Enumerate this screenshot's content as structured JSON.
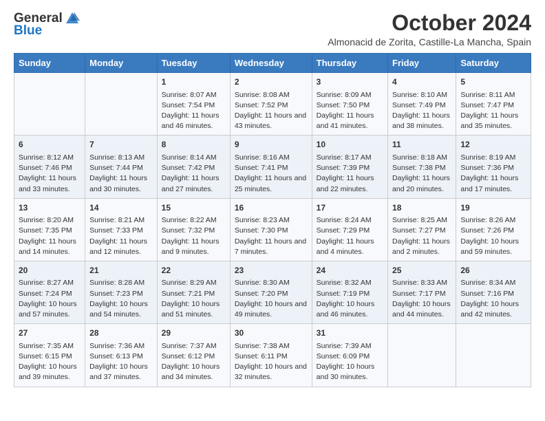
{
  "header": {
    "logo_general": "General",
    "logo_blue": "Blue",
    "month_title": "October 2024",
    "subtitle": "Almonacid de Zorita, Castille-La Mancha, Spain"
  },
  "days_of_week": [
    "Sunday",
    "Monday",
    "Tuesday",
    "Wednesday",
    "Thursday",
    "Friday",
    "Saturday"
  ],
  "weeks": [
    [
      {
        "day": "",
        "sunrise": "",
        "sunset": "",
        "daylight": ""
      },
      {
        "day": "",
        "sunrise": "",
        "sunset": "",
        "daylight": ""
      },
      {
        "day": "1",
        "sunrise": "Sunrise: 8:07 AM",
        "sunset": "Sunset: 7:54 PM",
        "daylight": "Daylight: 11 hours and 46 minutes."
      },
      {
        "day": "2",
        "sunrise": "Sunrise: 8:08 AM",
        "sunset": "Sunset: 7:52 PM",
        "daylight": "Daylight: 11 hours and 43 minutes."
      },
      {
        "day": "3",
        "sunrise": "Sunrise: 8:09 AM",
        "sunset": "Sunset: 7:50 PM",
        "daylight": "Daylight: 11 hours and 41 minutes."
      },
      {
        "day": "4",
        "sunrise": "Sunrise: 8:10 AM",
        "sunset": "Sunset: 7:49 PM",
        "daylight": "Daylight: 11 hours and 38 minutes."
      },
      {
        "day": "5",
        "sunrise": "Sunrise: 8:11 AM",
        "sunset": "Sunset: 7:47 PM",
        "daylight": "Daylight: 11 hours and 35 minutes."
      }
    ],
    [
      {
        "day": "6",
        "sunrise": "Sunrise: 8:12 AM",
        "sunset": "Sunset: 7:46 PM",
        "daylight": "Daylight: 11 hours and 33 minutes."
      },
      {
        "day": "7",
        "sunrise": "Sunrise: 8:13 AM",
        "sunset": "Sunset: 7:44 PM",
        "daylight": "Daylight: 11 hours and 30 minutes."
      },
      {
        "day": "8",
        "sunrise": "Sunrise: 8:14 AM",
        "sunset": "Sunset: 7:42 PM",
        "daylight": "Daylight: 11 hours and 27 minutes."
      },
      {
        "day": "9",
        "sunrise": "Sunrise: 8:16 AM",
        "sunset": "Sunset: 7:41 PM",
        "daylight": "Daylight: 11 hours and 25 minutes."
      },
      {
        "day": "10",
        "sunrise": "Sunrise: 8:17 AM",
        "sunset": "Sunset: 7:39 PM",
        "daylight": "Daylight: 11 hours and 22 minutes."
      },
      {
        "day": "11",
        "sunrise": "Sunrise: 8:18 AM",
        "sunset": "Sunset: 7:38 PM",
        "daylight": "Daylight: 11 hours and 20 minutes."
      },
      {
        "day": "12",
        "sunrise": "Sunrise: 8:19 AM",
        "sunset": "Sunset: 7:36 PM",
        "daylight": "Daylight: 11 hours and 17 minutes."
      }
    ],
    [
      {
        "day": "13",
        "sunrise": "Sunrise: 8:20 AM",
        "sunset": "Sunset: 7:35 PM",
        "daylight": "Daylight: 11 hours and 14 minutes."
      },
      {
        "day": "14",
        "sunrise": "Sunrise: 8:21 AM",
        "sunset": "Sunset: 7:33 PM",
        "daylight": "Daylight: 11 hours and 12 minutes."
      },
      {
        "day": "15",
        "sunrise": "Sunrise: 8:22 AM",
        "sunset": "Sunset: 7:32 PM",
        "daylight": "Daylight: 11 hours and 9 minutes."
      },
      {
        "day": "16",
        "sunrise": "Sunrise: 8:23 AM",
        "sunset": "Sunset: 7:30 PM",
        "daylight": "Daylight: 11 hours and 7 minutes."
      },
      {
        "day": "17",
        "sunrise": "Sunrise: 8:24 AM",
        "sunset": "Sunset: 7:29 PM",
        "daylight": "Daylight: 11 hours and 4 minutes."
      },
      {
        "day": "18",
        "sunrise": "Sunrise: 8:25 AM",
        "sunset": "Sunset: 7:27 PM",
        "daylight": "Daylight: 11 hours and 2 minutes."
      },
      {
        "day": "19",
        "sunrise": "Sunrise: 8:26 AM",
        "sunset": "Sunset: 7:26 PM",
        "daylight": "Daylight: 10 hours and 59 minutes."
      }
    ],
    [
      {
        "day": "20",
        "sunrise": "Sunrise: 8:27 AM",
        "sunset": "Sunset: 7:24 PM",
        "daylight": "Daylight: 10 hours and 57 minutes."
      },
      {
        "day": "21",
        "sunrise": "Sunrise: 8:28 AM",
        "sunset": "Sunset: 7:23 PM",
        "daylight": "Daylight: 10 hours and 54 minutes."
      },
      {
        "day": "22",
        "sunrise": "Sunrise: 8:29 AM",
        "sunset": "Sunset: 7:21 PM",
        "daylight": "Daylight: 10 hours and 51 minutes."
      },
      {
        "day": "23",
        "sunrise": "Sunrise: 8:30 AM",
        "sunset": "Sunset: 7:20 PM",
        "daylight": "Daylight: 10 hours and 49 minutes."
      },
      {
        "day": "24",
        "sunrise": "Sunrise: 8:32 AM",
        "sunset": "Sunset: 7:19 PM",
        "daylight": "Daylight: 10 hours and 46 minutes."
      },
      {
        "day": "25",
        "sunrise": "Sunrise: 8:33 AM",
        "sunset": "Sunset: 7:17 PM",
        "daylight": "Daylight: 10 hours and 44 minutes."
      },
      {
        "day": "26",
        "sunrise": "Sunrise: 8:34 AM",
        "sunset": "Sunset: 7:16 PM",
        "daylight": "Daylight: 10 hours and 42 minutes."
      }
    ],
    [
      {
        "day": "27",
        "sunrise": "Sunrise: 7:35 AM",
        "sunset": "Sunset: 6:15 PM",
        "daylight": "Daylight: 10 hours and 39 minutes."
      },
      {
        "day": "28",
        "sunrise": "Sunrise: 7:36 AM",
        "sunset": "Sunset: 6:13 PM",
        "daylight": "Daylight: 10 hours and 37 minutes."
      },
      {
        "day": "29",
        "sunrise": "Sunrise: 7:37 AM",
        "sunset": "Sunset: 6:12 PM",
        "daylight": "Daylight: 10 hours and 34 minutes."
      },
      {
        "day": "30",
        "sunrise": "Sunrise: 7:38 AM",
        "sunset": "Sunset: 6:11 PM",
        "daylight": "Daylight: 10 hours and 32 minutes."
      },
      {
        "day": "31",
        "sunrise": "Sunrise: 7:39 AM",
        "sunset": "Sunset: 6:09 PM",
        "daylight": "Daylight: 10 hours and 30 minutes."
      },
      {
        "day": "",
        "sunrise": "",
        "sunset": "",
        "daylight": ""
      },
      {
        "day": "",
        "sunrise": "",
        "sunset": "",
        "daylight": ""
      }
    ]
  ]
}
